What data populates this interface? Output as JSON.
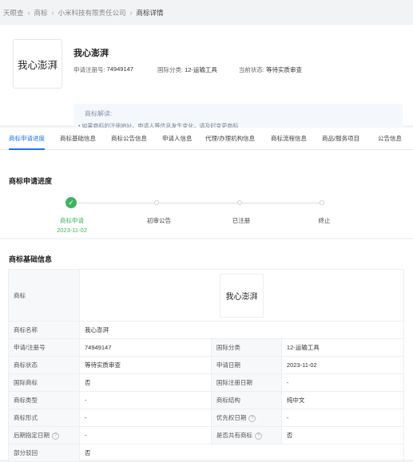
{
  "breadcrumb": [
    "天眼查",
    "商标",
    "小米科技有限责任公司",
    "商标详情"
  ],
  "header": {
    "logo_text": "我心澎湃",
    "name": "我心澎湃",
    "reg_label": "申请注册号:",
    "reg_value": "74949147",
    "class_label": "国际分类:",
    "class_value": "12-运输工具",
    "status_label": "当前状态:",
    "status_value": "等待实质审查",
    "interp_title": "商标解读:",
    "interp_line": "• 如果商标的注册地址、申请人等信息发生变化，请及时变更商标"
  },
  "tabs": [
    "商标申请进度",
    "商标基础信息",
    "商标公告信息",
    "申请人信息",
    "代理/办理机构信息",
    "商标流程信息",
    "商品/服务项目",
    "公告信息"
  ],
  "progress": {
    "title": "商标申请进度",
    "steps": [
      {
        "label": "商标申请",
        "date": "2023-11-02",
        "done": true
      },
      {
        "label": "初审公告",
        "date": "",
        "done": false
      },
      {
        "label": "已注册",
        "date": "",
        "done": false
      },
      {
        "label": "终止",
        "date": "",
        "done": false
      }
    ],
    "done_color": "#3fb35f"
  },
  "basic": {
    "title": "商标基础信息",
    "mark_label": "商标",
    "mark_image_text": "我心澎湃",
    "name_label": "商标名称",
    "name_value": "我心澎湃",
    "rows": [
      {
        "k1": "申请/注册号",
        "v1": "74949147",
        "k2": "国际分类",
        "v2": "12-运输工具"
      },
      {
        "k1": "商标状态",
        "v1": "等待实质审查",
        "k2": "申请日期",
        "v2": "2023-11-02"
      },
      {
        "k1": "国际商标",
        "v1": "否",
        "k2": "国际注册日期",
        "v2": "-"
      },
      {
        "k1": "商标类型",
        "v1": "-",
        "k2": "商标结构",
        "v2": "纯中文"
      },
      {
        "k1": "商标形式",
        "v1": "-",
        "k2": "优先权日期",
        "v2": "-"
      },
      {
        "k1": "后期指定日期",
        "v1": "-",
        "k2": "是否共有商标",
        "v2": "否"
      }
    ],
    "partial_label": "部分驳回",
    "partial_value": "否"
  },
  "accent_color": "#1e6fff"
}
